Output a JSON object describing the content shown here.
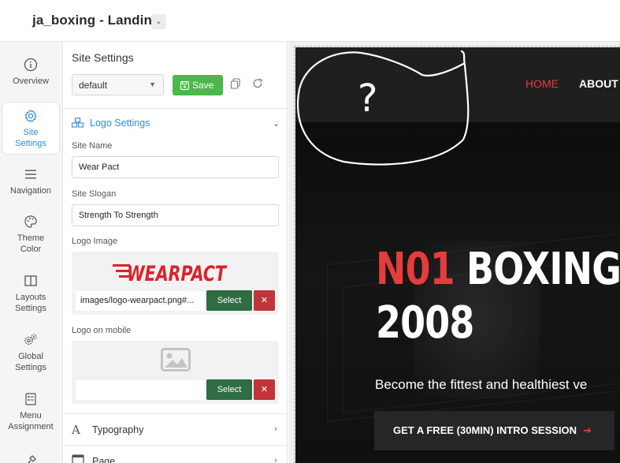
{
  "app": {
    "title": "ja_boxing - Landing"
  },
  "rail": {
    "items": [
      {
        "label": "Overview",
        "icon": "info-icon"
      },
      {
        "label": "Site\nSettings",
        "icon": "gear-icon"
      },
      {
        "label": "Navigation",
        "icon": "menu-icon"
      },
      {
        "label": "Theme\nColor",
        "icon": "palette-icon"
      },
      {
        "label": "Layouts\nSettings",
        "icon": "columns-icon"
      },
      {
        "label": "Global\nSettings",
        "icon": "gears-icon"
      },
      {
        "label": "Menu\nAssignment",
        "icon": "checklist-icon"
      }
    ]
  },
  "panel": {
    "title": "Site Settings",
    "preset": "default",
    "save_label": "Save",
    "section": {
      "title": "Logo Settings"
    },
    "fields": {
      "site_name": {
        "label": "Site Name",
        "value": "Wear Pact"
      },
      "site_slogan": {
        "label": "Site Slogan",
        "value": "Strength To Strength"
      },
      "logo_image": {
        "label": "Logo Image",
        "path": "images/logo-wearpact.png#...",
        "logo_text": "WEARPACT"
      },
      "logo_mobile": {
        "label": "Logo on mobile",
        "path": ""
      }
    },
    "select_label": "Select",
    "delete_label": "✕",
    "collapsed": [
      {
        "label": "Typography"
      },
      {
        "label": "Page"
      }
    ]
  },
  "preview": {
    "nav": {
      "home": "HOME",
      "about": "ABOUT"
    },
    "hero": {
      "title_red": "N01",
      "title_rest": " BOXING ST",
      "title_line2": "2008",
      "subtitle": "Become the fittest and healthiest ve",
      "cta": "GET A FREE (30MIN) INTRO SESSION",
      "cta_arrow": "➔"
    },
    "annotation": "?"
  },
  "colors": {
    "accent_blue": "#2a8ee0",
    "save_green": "#4cb84c",
    "select_green": "#2f6b43",
    "delete_red": "#c0343a",
    "brand_red": "#e53c3c",
    "logo_red": "#d9232e"
  }
}
